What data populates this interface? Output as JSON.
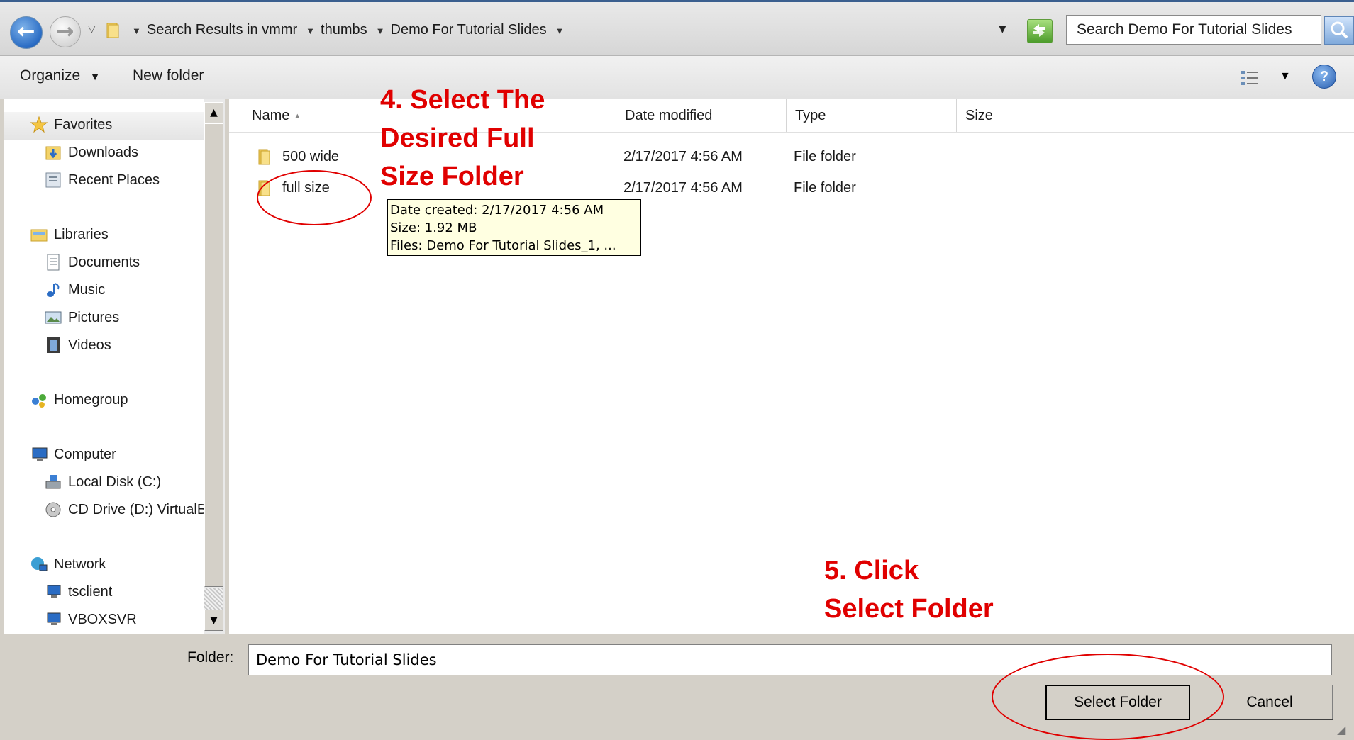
{
  "address_bar": {
    "crumbs": [
      "Search Results in vmmr",
      "thumbs",
      "Demo For Tutorial Slides"
    ],
    "search_placeholder": "Search Demo For Tutorial Slides"
  },
  "toolbar": {
    "organize_label": "Organize",
    "new_folder_label": "New folder"
  },
  "nav_pane": {
    "items": [
      {
        "label": "Favorites",
        "icon": "star-icon"
      },
      {
        "label": "Downloads",
        "icon": "downloads-folder-icon"
      },
      {
        "label": "Recent Places",
        "icon": "recent-places-icon"
      },
      {
        "label": "Libraries",
        "icon": "libraries-icon"
      },
      {
        "label": "Documents",
        "icon": "documents-icon"
      },
      {
        "label": "Music",
        "icon": "music-icon"
      },
      {
        "label": "Pictures",
        "icon": "pictures-icon"
      },
      {
        "label": "Videos",
        "icon": "videos-icon"
      },
      {
        "label": "Homegroup",
        "icon": "homegroup-icon"
      },
      {
        "label": "Computer",
        "icon": "computer-icon"
      },
      {
        "label": "Local Disk (C:)",
        "icon": "local-disk-icon"
      },
      {
        "label": "CD Drive (D:) VirtualBox Guest Additions",
        "icon": "cd-drive-icon"
      },
      {
        "label": "Network",
        "icon": "network-icon"
      },
      {
        "label": "tsclient",
        "icon": "network-computer-icon"
      },
      {
        "label": "VBOXSVR",
        "icon": "network-computer-icon"
      }
    ]
  },
  "file_list": {
    "columns": [
      "Name",
      "Date modified",
      "Type",
      "Size"
    ],
    "rows": [
      {
        "name": "500 wide",
        "date": "2/17/2017 4:56 AM",
        "type": "File folder",
        "size": ""
      },
      {
        "name": "full size",
        "date": "2/17/2017 4:56 AM",
        "type": "File folder",
        "size": ""
      }
    ]
  },
  "tooltip": {
    "line1": "Date created: 2/17/2017 4:56 AM",
    "line2": "Size: 1.92 MB",
    "line3": "Files: Demo For Tutorial Slides_1, ..."
  },
  "footer": {
    "folder_label": "Folder:",
    "folder_value": "Demo For Tutorial Slides",
    "select_label": "Select Folder",
    "cancel_label": "Cancel"
  },
  "annotations": {
    "step4_line1": "4. Select The",
    "step4_line2": "Desired Full",
    "step4_line3": "Size Folder",
    "step5_line1": "5. Click",
    "step5_line2": "Select Folder"
  },
  "colors": {
    "annotation": "#e00000",
    "tooltip_bg": "#ffffe1",
    "dialog_bg": "#d4d0c8"
  }
}
